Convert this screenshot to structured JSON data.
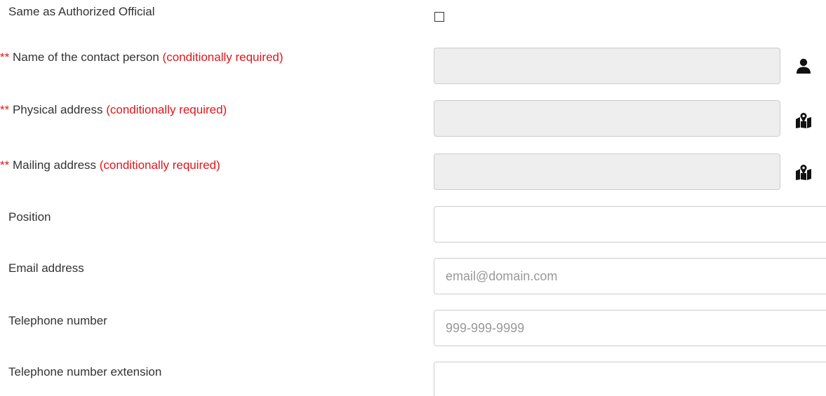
{
  "form": {
    "same_as": {
      "label": "Same as Authorized Official",
      "checked": false
    },
    "contact_name": {
      "required_mark": "**",
      "label": "Name of the contact person",
      "condition": "(conditionally required)",
      "value": "",
      "icon": "user-icon"
    },
    "physical_address": {
      "required_mark": "**",
      "label": "Physical address",
      "condition": "(conditionally required)",
      "value": "",
      "icon": "map-marker-icon"
    },
    "mailing_address": {
      "required_mark": "**",
      "label": "Mailing address",
      "condition": "(conditionally required)",
      "value": "",
      "icon": "map-marker-icon"
    },
    "position": {
      "label": "Position",
      "value": "",
      "placeholder": ""
    },
    "email": {
      "label": "Email address",
      "value": "",
      "placeholder": "email@domain.com"
    },
    "telephone": {
      "label": "Telephone number",
      "value": "",
      "placeholder": "999-999-9999"
    },
    "telephone_ext": {
      "label": "Telephone number extension",
      "value": "",
      "placeholder": ""
    }
  },
  "colors": {
    "required": "#e0161b",
    "text": "#333333",
    "disabled_bg": "#eeeeee",
    "border": "#cccccc"
  }
}
